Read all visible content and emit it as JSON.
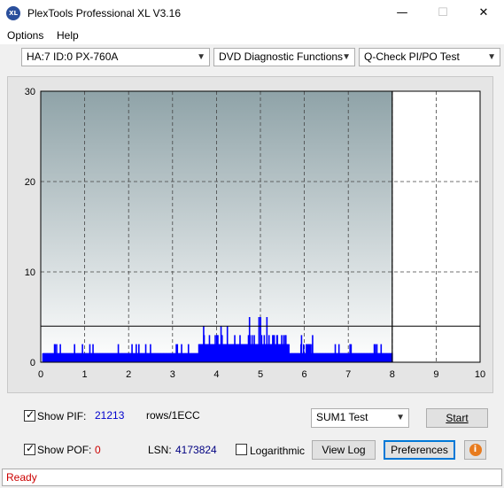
{
  "window": {
    "title": "PlexTools Professional XL V3.16",
    "icon_text": "XL",
    "minimize": "—",
    "maximize": "☐",
    "close": "✕"
  },
  "menu": {
    "options": "Options",
    "help": "Help"
  },
  "selectors": {
    "drive": "HA:7 ID:0  PX-760A",
    "function": "DVD Diagnostic Functions",
    "test": "Q-Check PI/PO Test"
  },
  "chart_data": {
    "type": "bar",
    "title": "",
    "xlabel": "",
    "ylabel": "",
    "xlim": [
      0,
      10
    ],
    "ylim": [
      0,
      30
    ],
    "x_ticks": [
      "0",
      "1",
      "2",
      "3",
      "4",
      "5",
      "6",
      "7",
      "8",
      "9",
      "10"
    ],
    "y_ticks": [
      "0",
      "10",
      "20",
      "30"
    ],
    "grid": true,
    "threshold_line": 4,
    "scan_end": 8,
    "series": [
      {
        "color": "#0000ff",
        "description": "PIF per 1ECC block, scanned 0–8 GB",
        "segments": [
          {
            "x_start": 0.05,
            "x_end": 3.6,
            "typical": 1,
            "max": 2
          },
          {
            "x_start": 3.6,
            "x_end": 4.5,
            "typical": 2,
            "max": 4
          },
          {
            "x_start": 4.5,
            "x_end": 5.6,
            "typical": 2,
            "max": 5
          },
          {
            "x_start": 5.6,
            "x_end": 6.2,
            "typical": 1,
            "max": 3
          },
          {
            "x_start": 6.2,
            "x_end": 8.0,
            "typical": 1,
            "max": 2
          }
        ]
      }
    ]
  },
  "controls": {
    "show_pif_label": "Show PIF:",
    "show_pif_checked": true,
    "pif_value": "21213",
    "pif_unit": "rows/1ECC",
    "show_pof_label": "Show POF:",
    "show_pof_checked": true,
    "pof_value": "0",
    "lsn_label": "LSN:",
    "lsn_value": "4173824",
    "logarithmic_label": "Logarithmic",
    "logarithmic_checked": false,
    "test_mode": "SUM1 Test",
    "start_button": "Start",
    "view_log_button": "View Log",
    "preferences_button": "Preferences"
  },
  "status": {
    "text": "Ready"
  },
  "colors": {
    "pif": "#0000cc",
    "pof": "#cc0000",
    "status": "#cc0000",
    "bars": "#0000ff"
  }
}
